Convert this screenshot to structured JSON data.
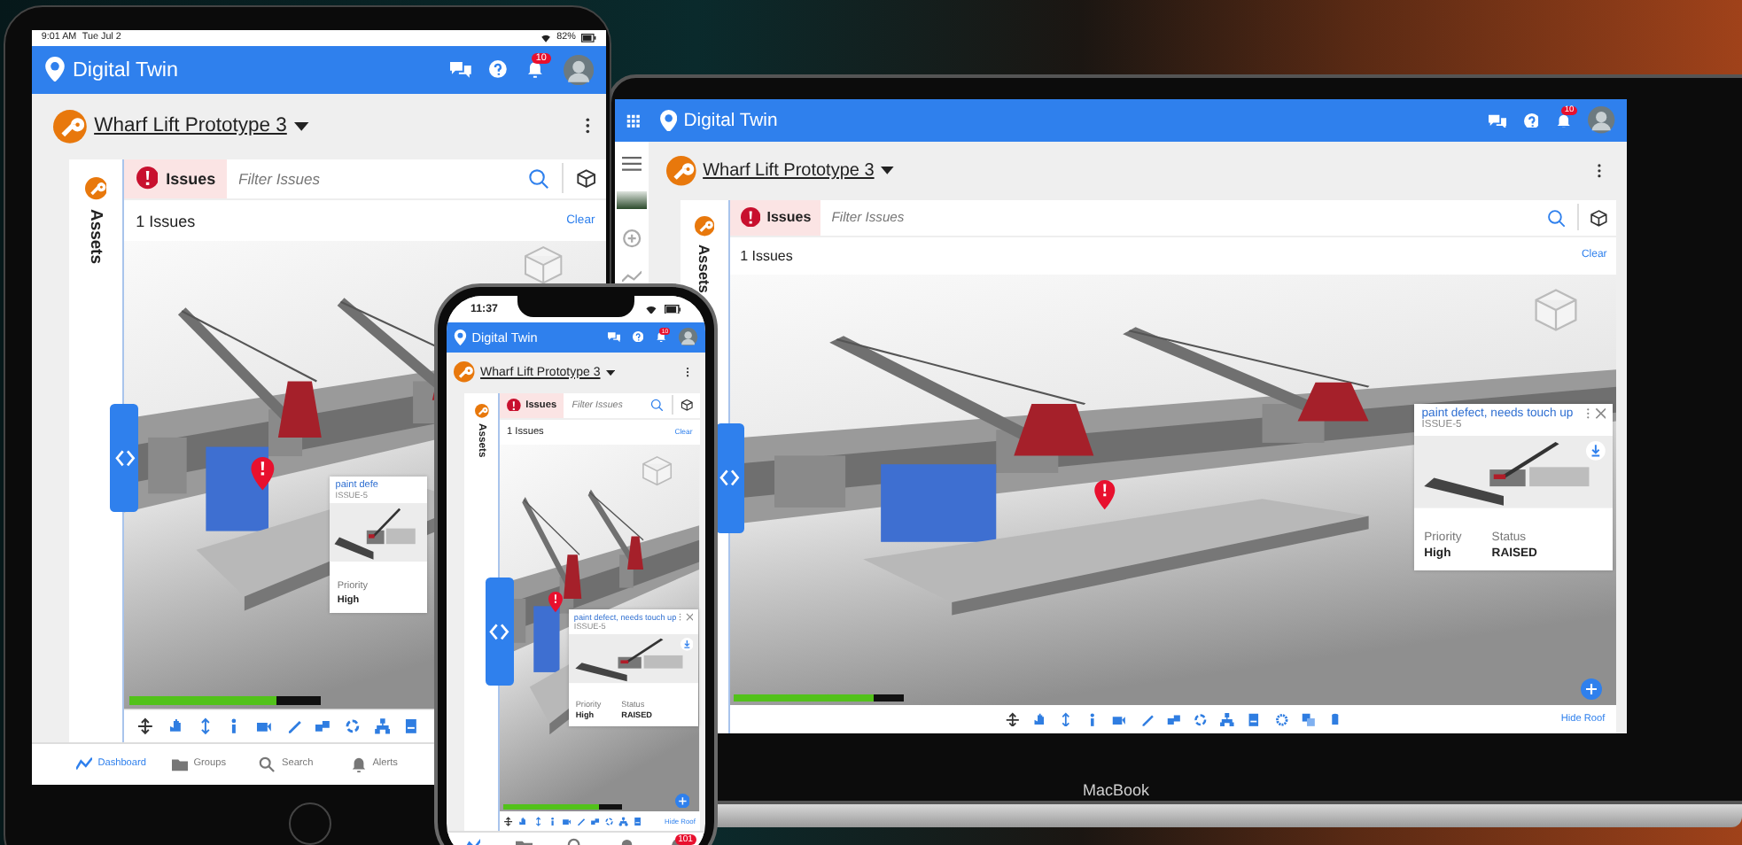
{
  "devices": [
    {
      "kind": "tablet",
      "status_bar": {
        "time": "9:01 AM",
        "date": "Tue Jul 2",
        "battery": "82%"
      },
      "app": {
        "title": "Digital Twin",
        "notifications": "10",
        "project": "Wharf Lift Prototype 3",
        "sidebar_label": "Assets",
        "issues_tab": {
          "label": "Issues",
          "selected": true
        },
        "filter_placeholder": "Filter Issues",
        "issue_count": "1 Issues",
        "clear": "Clear",
        "issue_card": {
          "title": "paint defe",
          "id": "ISSUE-5",
          "fields": [
            {
              "label": "Priority",
              "value": "High"
            }
          ]
        },
        "progress": {
          "level": 0.77
        },
        "bottom_nav": [
          {
            "label": "Dashboard",
            "selected": true
          },
          {
            "label": "Groups",
            "selected": false
          },
          {
            "label": "Search",
            "selected": false
          },
          {
            "label": "Alerts",
            "selected": false
          }
        ]
      }
    },
    {
      "kind": "laptop",
      "label": "MacBook",
      "app": {
        "title": "Digital Twin",
        "notifications": "10",
        "project": "Wharf Lift Prototype 3",
        "sidebar_label": "Assets",
        "issues_tab": {
          "label": "Issues",
          "selected": true
        },
        "filter_placeholder": "Filter Issues",
        "issue_count": "1 Issues",
        "clear": "Clear",
        "issue_card": {
          "title": "paint defect, needs touch up",
          "id": "ISSUE-5",
          "fields": [
            {
              "label": "Priority",
              "value": "High"
            },
            {
              "label": "Status",
              "value": "RAISED"
            }
          ]
        },
        "progress": {
          "level": 0.82
        },
        "hide_roof": "Hide Roof"
      }
    },
    {
      "kind": "phone",
      "status_bar": {
        "time": "11:37"
      },
      "app": {
        "title": "Digital Twin",
        "notifications": "10",
        "project": "Wharf Lift Prototype 3",
        "sidebar_label": "Assets",
        "issues_tab": {
          "label": "Issues",
          "selected": true
        },
        "filter_placeholder": "Filter Issues",
        "issue_count": "1 Issues",
        "clear": "Clear",
        "issue_card": {
          "title": "paint defect, needs touch up",
          "id": "ISSUE-5",
          "fields": [
            {
              "label": "Priority",
              "value": "High"
            },
            {
              "label": "Status",
              "value": "RAISED"
            }
          ]
        },
        "progress": {
          "level": 0.8
        },
        "hide_roof": "Hide Roof",
        "bottom_nav": [
          {
            "selected": true
          },
          {
            "selected": false
          },
          {
            "selected": false
          },
          {
            "selected": false
          },
          {
            "selected": false,
            "badge": "101"
          }
        ]
      }
    }
  ]
}
